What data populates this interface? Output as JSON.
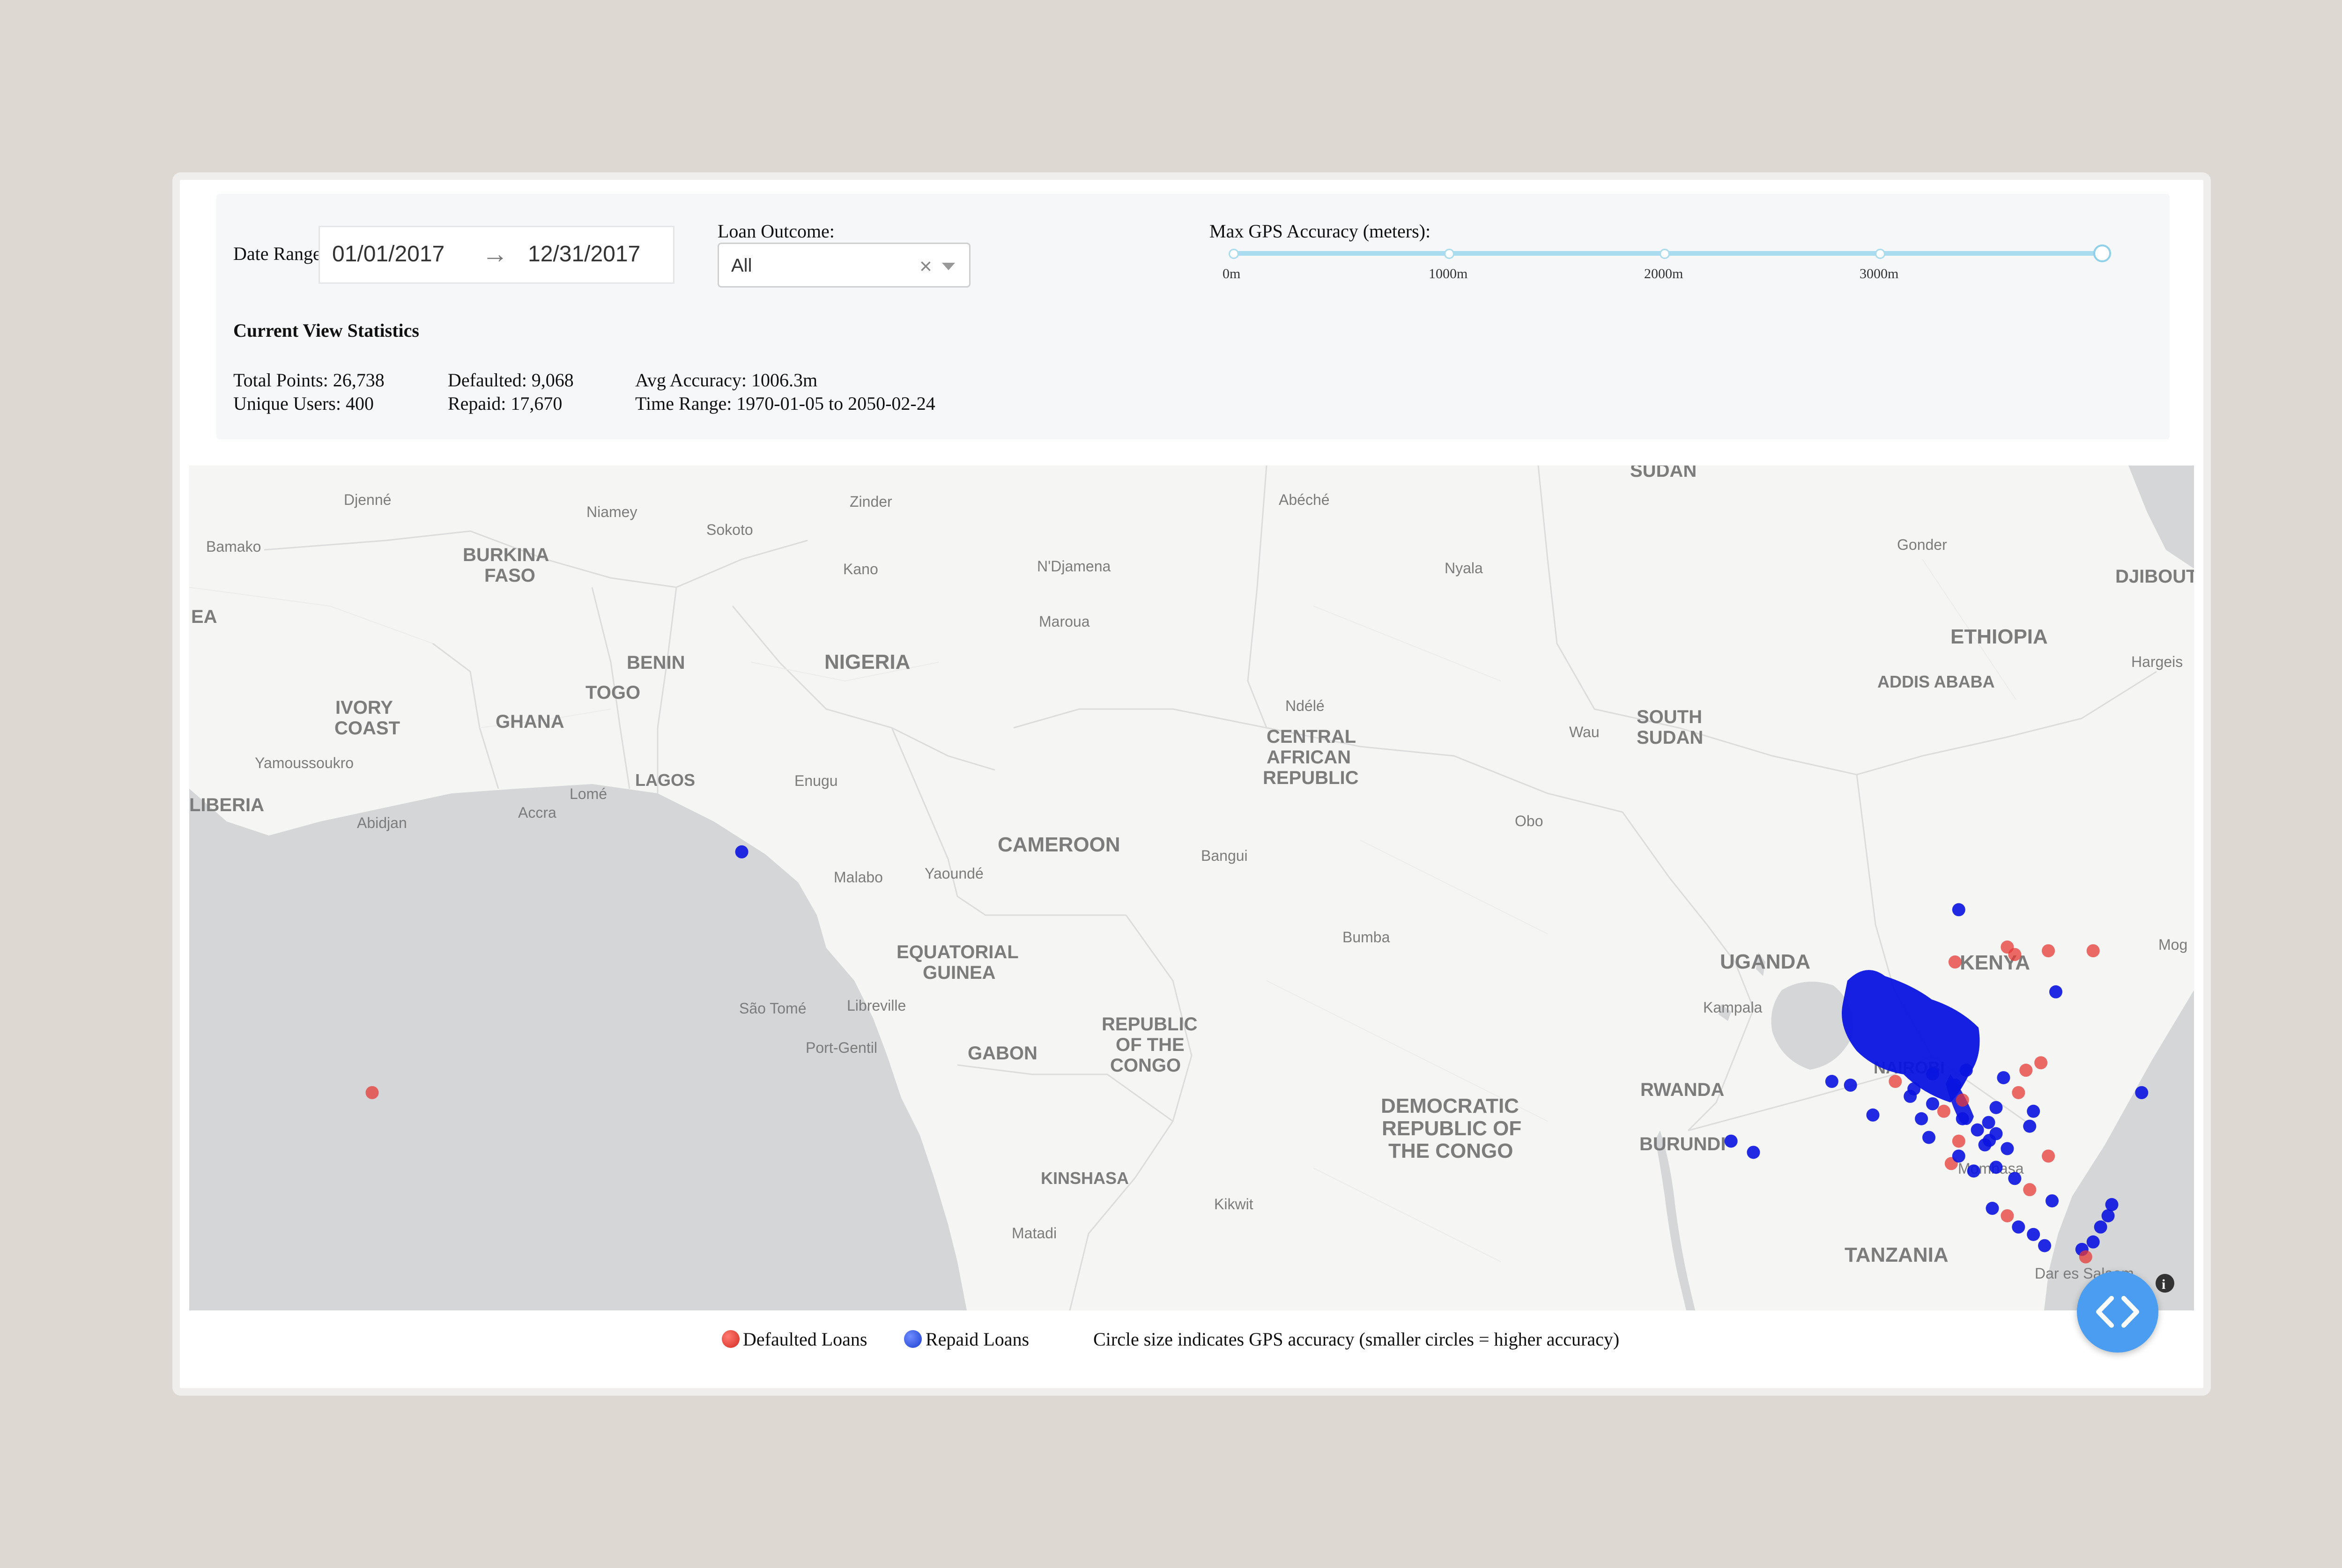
{
  "controls": {
    "date_range_label": "Date Range:",
    "start_date": "01/01/2017",
    "end_date": "12/31/2017",
    "arrow": "→",
    "loan_outcome_label": "Loan Outcome:",
    "loan_outcome_value": "All",
    "clear_symbol": "×",
    "gps_label": "Max GPS Accuracy (meters):",
    "gps_ticks": [
      "0m",
      "1000m",
      "2000m",
      "3000m"
    ],
    "gps_max_fraction": 1.0
  },
  "stats": {
    "title": "Current View Statistics",
    "total_points": "Total Points: 26,738",
    "unique_users": "Unique Users: 400",
    "defaulted": "Defaulted: 9,068",
    "repaid": "Repaid: 17,670",
    "avg_accuracy": "Avg Accuracy: 1006.3m",
    "time_range": "Time Range: 1970-01-05 to 2050-02-24"
  },
  "map": {
    "place_labels": {
      "djenne": "Djenné",
      "niamey": "Niamey",
      "zinder": "Zinder",
      "abeche": "Abéché",
      "sudan": "SUDAN",
      "bamako": "Bamako",
      "sokoto": "Sokoto",
      "burkina_faso_1": "BURKINA",
      "burkina_faso_2": "FASO",
      "kano": "Kano",
      "ndjamena": "N'Djamena",
      "nyala": "Nyala",
      "gonder": "Gonder",
      "djibouti": "DJIBOUT",
      "ea": "EA",
      "maroua": "Maroua",
      "ethiopia": "ETHIOPIA",
      "benin": "BENIN",
      "nigeria": "NIGERIA",
      "hargeis": "Hargeis",
      "addis_ababa": "ADDIS ABABA",
      "togo": "TOGO",
      "ivory_coast_1": "IVORY",
      "ivory_coast_2": "COAST",
      "ghana": "GHANA",
      "ndele": "Ndélé",
      "south_sudan_1": "SOUTH",
      "south_sudan_2": "SUDAN",
      "car_1": "CENTRAL",
      "car_2": "AFRICAN",
      "car_3": "REPUBLIC",
      "wau": "Wau",
      "yamoussoukro": "Yamoussoukro",
      "lagos": "LAGOS",
      "enugu": "Enugu",
      "lome": "Lomé",
      "liberia": "LIBERIA",
      "abidjan": "Abidjan",
      "accra": "Accra",
      "obo": "Obo",
      "cameroon": "CAMEROON",
      "bangui": "Bangui",
      "malabo": "Malabo",
      "yaounde": "Yaoundé",
      "kenya": "KENYA",
      "uganda": "UGANDA",
      "mog": "Mog",
      "bumba": "Bumba",
      "eq_guinea_1": "EQUATORIAL",
      "eq_guinea_2": "GUINEA",
      "sao_tome": "São Tomé",
      "libreville": "Libreville",
      "kampala": "Kampala",
      "port_gentil": "Port-Gentil",
      "gabon": "GABON",
      "roc_1": "REPUBLIC",
      "roc_2": "OF THE",
      "roc_3": "CONGO",
      "nairobi": "NAIROBI",
      "rwanda": "RWANDA",
      "drc_1": "DEMOCRATIC",
      "drc_2": "REPUBLIC OF",
      "drc_3": "THE CONGO",
      "burundi": "BURUNDI",
      "mombasa": "Mombasa",
      "kinshasa": "KINSHASA",
      "kikwit": "Kikwit",
      "matadi": "Matadi",
      "tanzania": "TANZANIA",
      "dar_es_salaam": "Dar es Salaam"
    },
    "points": [
      {
        "lat": 6.45,
        "lon": 3.4,
        "outcome": "repaid"
      },
      {
        "lat": 0.0,
        "lon": -6.5,
        "outcome": "defaulted"
      },
      {
        "lat": 4.9,
        "lon": 36.0,
        "outcome": "repaid"
      },
      {
        "lat": 3.9,
        "lon": 37.3,
        "outcome": "defaulted"
      },
      {
        "lat": 3.7,
        "lon": 37.5,
        "outcome": "defaulted"
      },
      {
        "lat": 3.8,
        "lon": 38.4,
        "outcome": "defaulted"
      },
      {
        "lat": 3.8,
        "lon": 39.6,
        "outcome": "defaulted"
      },
      {
        "lat": 3.5,
        "lon": 35.9,
        "outcome": "defaulted"
      },
      {
        "lat": 2.7,
        "lon": 38.6,
        "outcome": "repaid"
      },
      {
        "lat": 0.3,
        "lon": 32.6,
        "outcome": "repaid"
      },
      {
        "lat": 0.2,
        "lon": 33.1,
        "outcome": "repaid"
      },
      {
        "lat": -0.6,
        "lon": 33.7,
        "outcome": "repaid"
      },
      {
        "lat": 0.8,
        "lon": 38.2,
        "outcome": "defaulted"
      },
      {
        "lat": 0.6,
        "lon": 37.8,
        "outcome": "defaulted"
      },
      {
        "lat": -1.7,
        "lon": 38.4,
        "outcome": "defaulted"
      },
      {
        "lat": -1.3,
        "lon": 29.9,
        "outcome": "repaid"
      },
      {
        "lat": -1.6,
        "lon": 30.5,
        "outcome": "repaid"
      },
      {
        "lat": 0.0,
        "lon": 40.9,
        "outcome": "repaid"
      },
      {
        "lat": -3.1,
        "lon": 36.9,
        "outcome": "repaid"
      },
      {
        "lat": -3.3,
        "lon": 37.3,
        "outcome": "defaulted"
      },
      {
        "lat": -3.6,
        "lon": 37.6,
        "outcome": "repaid"
      },
      {
        "lat": -3.8,
        "lon": 38.0,
        "outcome": "repaid"
      },
      {
        "lat": -4.1,
        "lon": 38.3,
        "outcome": "repaid"
      },
      {
        "lat": -6.8,
        "lon": 38.0,
        "outcome": "repaid"
      },
      {
        "lat": -1.28,
        "lon": 36.82,
        "outcome": "repaid"
      },
      {
        "lat": -1.0,
        "lon": 36.5,
        "outcome": "repaid"
      },
      {
        "lat": -0.7,
        "lon": 36.1,
        "outcome": "repaid"
      },
      {
        "lat": -0.5,
        "lon": 35.6,
        "outcome": "defaulted"
      },
      {
        "lat": -0.3,
        "lon": 35.3,
        "outcome": "repaid"
      },
      {
        "lat": 0.1,
        "lon": 34.8,
        "outcome": "repaid"
      },
      {
        "lat": 0.5,
        "lon": 35.3,
        "outcome": "repaid"
      },
      {
        "lat": 0.3,
        "lon": 34.3,
        "outcome": "defaulted"
      },
      {
        "lat": -0.1,
        "lon": 34.7,
        "outcome": "repaid"
      },
      {
        "lat": -1.5,
        "lon": 37.3,
        "outcome": "repaid"
      },
      {
        "lat": -2.0,
        "lon": 37.0,
        "outcome": "repaid"
      },
      {
        "lat": -2.3,
        "lon": 37.5,
        "outcome": "repaid"
      },
      {
        "lat": -0.4,
        "lon": 37.0,
        "outcome": "repaid"
      },
      {
        "lat": -0.2,
        "lon": 36.1,
        "outcome": "defaulted"
      },
      {
        "lat": -1.9,
        "lon": 35.8,
        "outcome": "defaulted"
      },
      {
        "lat": -1.1,
        "lon": 37.0,
        "outcome": "repaid"
      },
      {
        "lat": -0.9,
        "lon": 37.9,
        "outcome": "repaid"
      },
      {
        "lat": -1.7,
        "lon": 36.0,
        "outcome": "repaid"
      },
      {
        "lat": 0.0,
        "lon": 37.6,
        "outcome": "defaulted"
      },
      {
        "lat": -0.5,
        "lon": 38.0,
        "outcome": "repaid"
      },
      {
        "lat": 0.2,
        "lon": 35.9,
        "outcome": "repaid"
      },
      {
        "lat": -2.6,
        "lon": 37.9,
        "outcome": "defaulted"
      },
      {
        "lat": -2.9,
        "lon": 38.5,
        "outcome": "repaid"
      },
      {
        "lat": -4.2,
        "lon": 39.3,
        "outcome": "repaid"
      },
      {
        "lat": -3.3,
        "lon": 40.0,
        "outcome": "repaid"
      },
      {
        "lat": -3.6,
        "lon": 39.8,
        "outcome": "repaid"
      },
      {
        "lat": -4.0,
        "lon": 39.6,
        "outcome": "repaid"
      },
      {
        "lat": -3.0,
        "lon": 40.1,
        "outcome": "repaid"
      },
      {
        "lat": -4.4,
        "lon": 39.4,
        "outcome": "defaulted"
      },
      {
        "lat": -1.4,
        "lon": 36.7,
        "outcome": "repaid"
      },
      {
        "lat": -0.8,
        "lon": 36.8,
        "outcome": "repaid"
      },
      {
        "lat": 0.6,
        "lon": 36.2,
        "outcome": "repaid"
      },
      {
        "lat": -1.3,
        "lon": 36.0,
        "outcome": "defaulted"
      },
      {
        "lat": -1.2,
        "lon": 35.2,
        "outcome": "repaid"
      },
      {
        "lat": -2.1,
        "lon": 36.4,
        "outcome": "repaid"
      },
      {
        "lat": -0.7,
        "lon": 35.0,
        "outcome": "repaid"
      },
      {
        "lat": 0.4,
        "lon": 37.2,
        "outcome": "repaid"
      }
    ]
  },
  "legend": {
    "defaulted_label": "Defaulted Loans",
    "repaid_label": "Repaid Loans",
    "note": "Circle size indicates GPS accuracy (smaller circles = higher accuracy)"
  },
  "colors": {
    "defaulted": "#e53935",
    "repaid": "#0a14e0",
    "slider": "#a9dcee",
    "accent": "#4a9df0"
  }
}
